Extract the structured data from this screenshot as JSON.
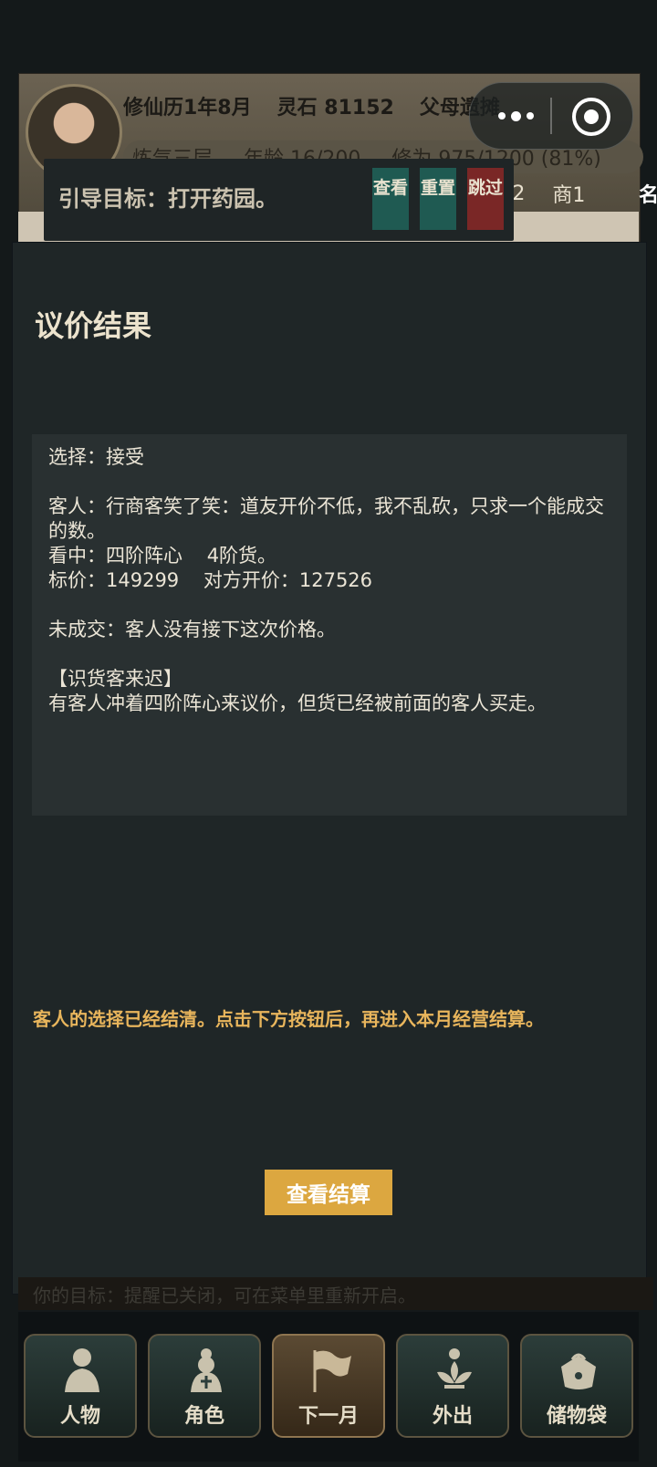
{
  "header": {
    "calendar": "修仙历1年8月",
    "spirit_stones": "灵石 81152",
    "event": "父母遗摊",
    "realm": "炼气三层",
    "age": "年龄 16/200",
    "cultivation": "修为 975/1200 (81%)",
    "stat_a": "/12",
    "stat_b": "商1",
    "stat_c": "名"
  },
  "guide": {
    "text": "引导目标：打开药园。",
    "view_label": "查看",
    "reset_label": "重置",
    "skip_label": "跳过"
  },
  "modal": {
    "title": "议价结果",
    "lines": {
      "choice": "选择：接受",
      "guest": "客人：行商客笑了笑：道友开价不低，我不乱砍，只求一个能成交的数。",
      "interest": "看中：四阶阵心    4阶货。",
      "price": "标价：149299    对方开价：127526",
      "result": "未成交：客人没有接下这次价格。",
      "event_title": "【识货客来迟】",
      "event_desc": "有客人冲着四阶阵心来议价，但货已经被前面的客人买走。"
    },
    "notice": "客人的选择已经结清。点击下方按钮后，再进入本月经营结算。",
    "button_label": "查看结算"
  },
  "status_bar": "你的目标：提醒已关闭，可在菜单里重新开启。",
  "nav": [
    {
      "label": "人物",
      "icon": "person-icon"
    },
    {
      "label": "角色",
      "icon": "character-icon"
    },
    {
      "label": "下一月",
      "icon": "flag-icon"
    },
    {
      "label": "外出",
      "icon": "lotus-icon"
    },
    {
      "label": "储物袋",
      "icon": "bag-icon"
    }
  ],
  "colors": {
    "accent": "#dca740",
    "notice": "#e8b55c",
    "modal_bg": "#1f2627",
    "box_bg": "#293031"
  }
}
